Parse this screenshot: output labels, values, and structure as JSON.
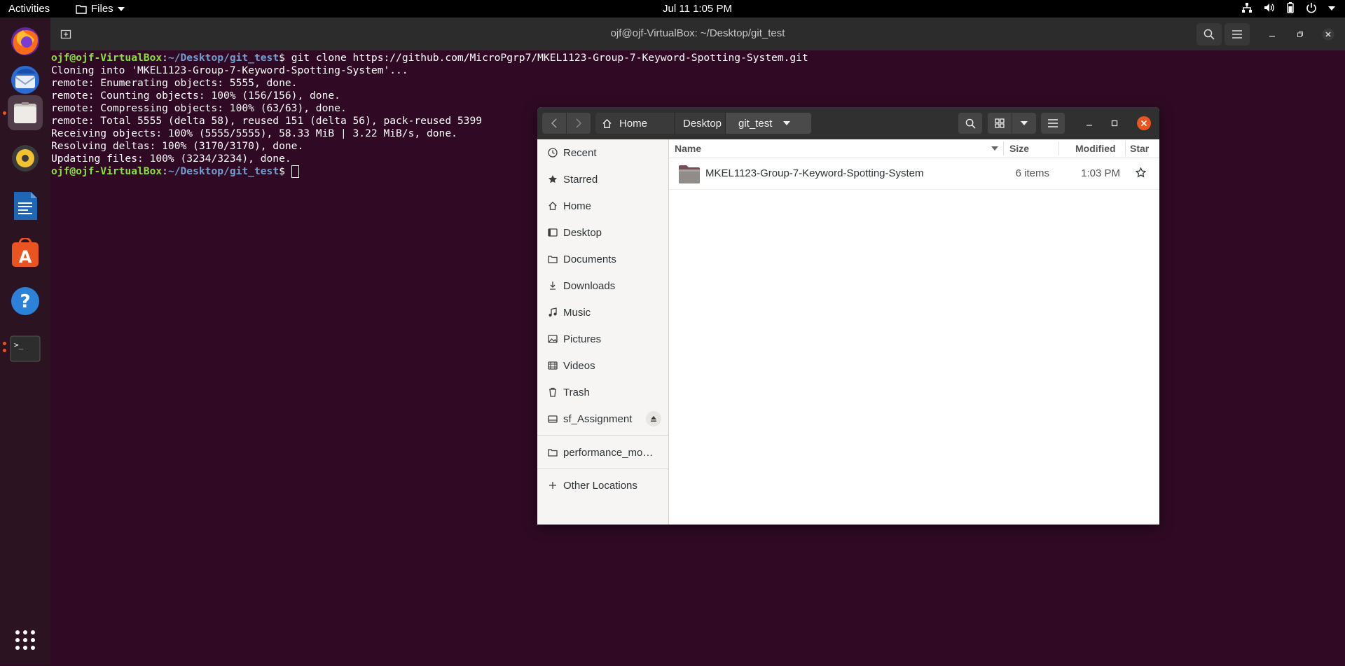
{
  "topbar": {
    "activities": "Activities",
    "app_menu": "Files",
    "clock": "Jul 11  1:05 PM"
  },
  "terminal": {
    "title": "ojf@ojf-VirtualBox: ~/Desktop/git_test",
    "prompt_user": "ojf@ojf-VirtualBox",
    "prompt_path": "~/Desktop/git_test",
    "command": " git clone https://github.com/MicroPgrp7/MKEL1123-Group-7-Keyword-Spotting-System.git",
    "output": [
      "Cloning into 'MKEL1123-Group-7-Keyword-Spotting-System'...",
      "remote: Enumerating objects: 5555, done.",
      "remote: Counting objects: 100% (156/156), done.",
      "remote: Compressing objects: 100% (63/63), done.",
      "remote: Total 5555 (delta 58), reused 151 (delta 56), pack-reused 5399",
      "Receiving objects: 100% (5555/5555), 58.33 MiB | 3.22 MiB/s, done.",
      "Resolving deltas: 100% (3170/3170), done.",
      "Updating files: 100% (3234/3234), done."
    ]
  },
  "files": {
    "breadcrumb": [
      "Home",
      "Desktop",
      "git_test"
    ],
    "sidebar": [
      {
        "label": "Recent",
        "icon": "clock-icon"
      },
      {
        "label": "Starred",
        "icon": "star-icon"
      },
      {
        "label": "Home",
        "icon": "home-icon"
      },
      {
        "label": "Desktop",
        "icon": "desktop-icon"
      },
      {
        "label": "Documents",
        "icon": "document-icon"
      },
      {
        "label": "Downloads",
        "icon": "download-icon"
      },
      {
        "label": "Music",
        "icon": "music-icon"
      },
      {
        "label": "Pictures",
        "icon": "picture-icon"
      },
      {
        "label": "Videos",
        "icon": "video-icon"
      },
      {
        "label": "Trash",
        "icon": "trash-icon"
      },
      {
        "label": "sf_Assignment",
        "icon": "drive-icon"
      },
      {
        "label": "performance_mo…",
        "icon": "folder-icon"
      },
      {
        "label": "Other Locations",
        "icon": "plus-icon"
      }
    ],
    "columns": {
      "name": "Name",
      "size": "Size",
      "modified": "Modified",
      "star": "Star"
    },
    "rows": [
      {
        "name": "MKEL1123-Group-7-Keyword-Spotting-System",
        "size": "6 items",
        "modified": "1:03 PM"
      }
    ]
  }
}
